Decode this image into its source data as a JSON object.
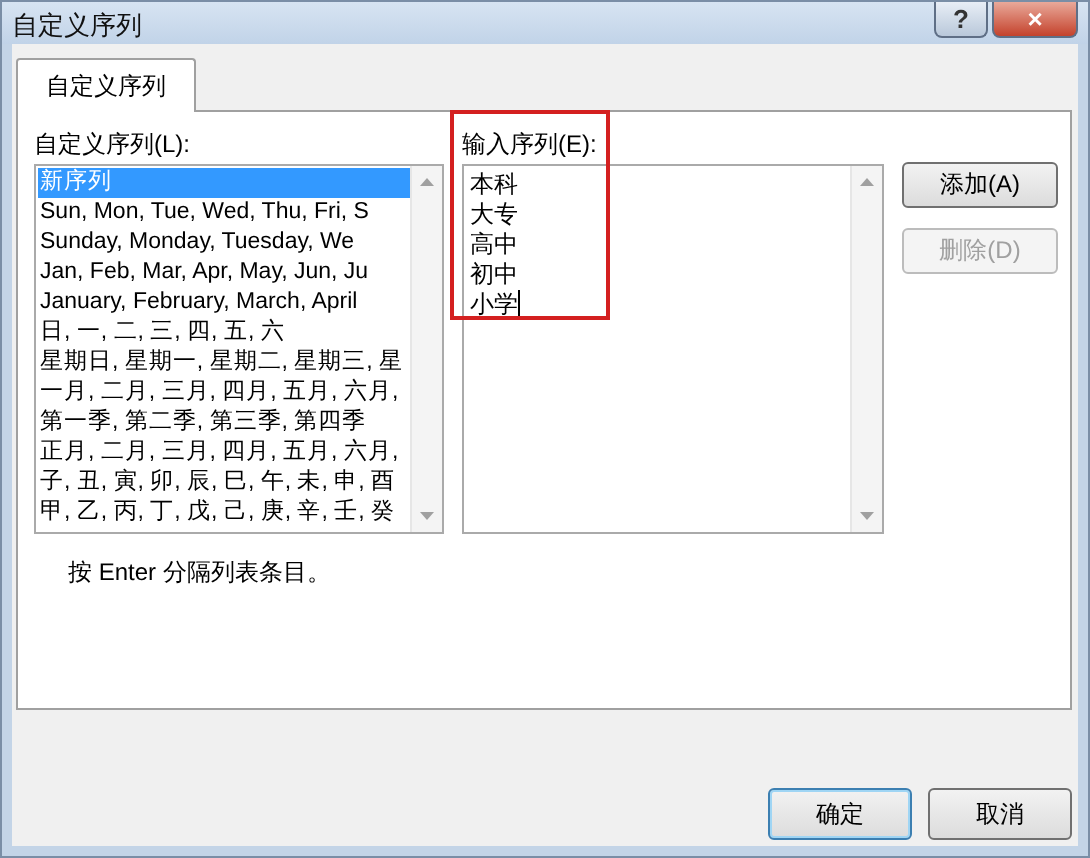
{
  "window": {
    "title": "自定义序列",
    "help_button": "?",
    "close_button": "×"
  },
  "tabs": [
    {
      "label": "自定义序列",
      "selected": true
    }
  ],
  "custom_lists": {
    "label": "自定义序列(L):",
    "items": [
      {
        "text": "新序列",
        "selected": true
      },
      {
        "text": "Sun, Mon, Tue, Wed, Thu, Fri, S",
        "selected": false
      },
      {
        "text": "Sunday, Monday, Tuesday, We",
        "selected": false
      },
      {
        "text": "Jan, Feb, Mar, Apr, May, Jun, Ju",
        "selected": false
      },
      {
        "text": "January, February, March, April",
        "selected": false
      },
      {
        "text": "日, 一, 二, 三, 四, 五, 六",
        "selected": false
      },
      {
        "text": "星期日, 星期一, 星期二, 星期三, 星",
        "selected": false
      },
      {
        "text": "一月, 二月, 三月, 四月, 五月, 六月,",
        "selected": false
      },
      {
        "text": "第一季, 第二季, 第三季, 第四季",
        "selected": false
      },
      {
        "text": "正月, 二月, 三月, 四月, 五月, 六月,",
        "selected": false
      },
      {
        "text": "子, 丑, 寅, 卯, 辰, 巳, 午, 未, 申, 酉",
        "selected": false
      },
      {
        "text": "甲, 乙, 丙, 丁, 戊, 己, 庚, 辛, 壬, 癸",
        "selected": false
      }
    ]
  },
  "list_entries": {
    "label": "输入序列(E):",
    "lines": [
      "本科",
      "大专",
      "高中",
      "初中",
      "小学"
    ],
    "focused": true,
    "highlighted": true
  },
  "side_buttons": [
    {
      "label": "添加(A)",
      "disabled": false
    },
    {
      "label": "删除(D)",
      "disabled": true
    }
  ],
  "hint": "按 Enter 分隔列表条目。",
  "buttons": [
    {
      "label": "确定",
      "default": true
    },
    {
      "label": "取消",
      "default": false
    }
  ]
}
